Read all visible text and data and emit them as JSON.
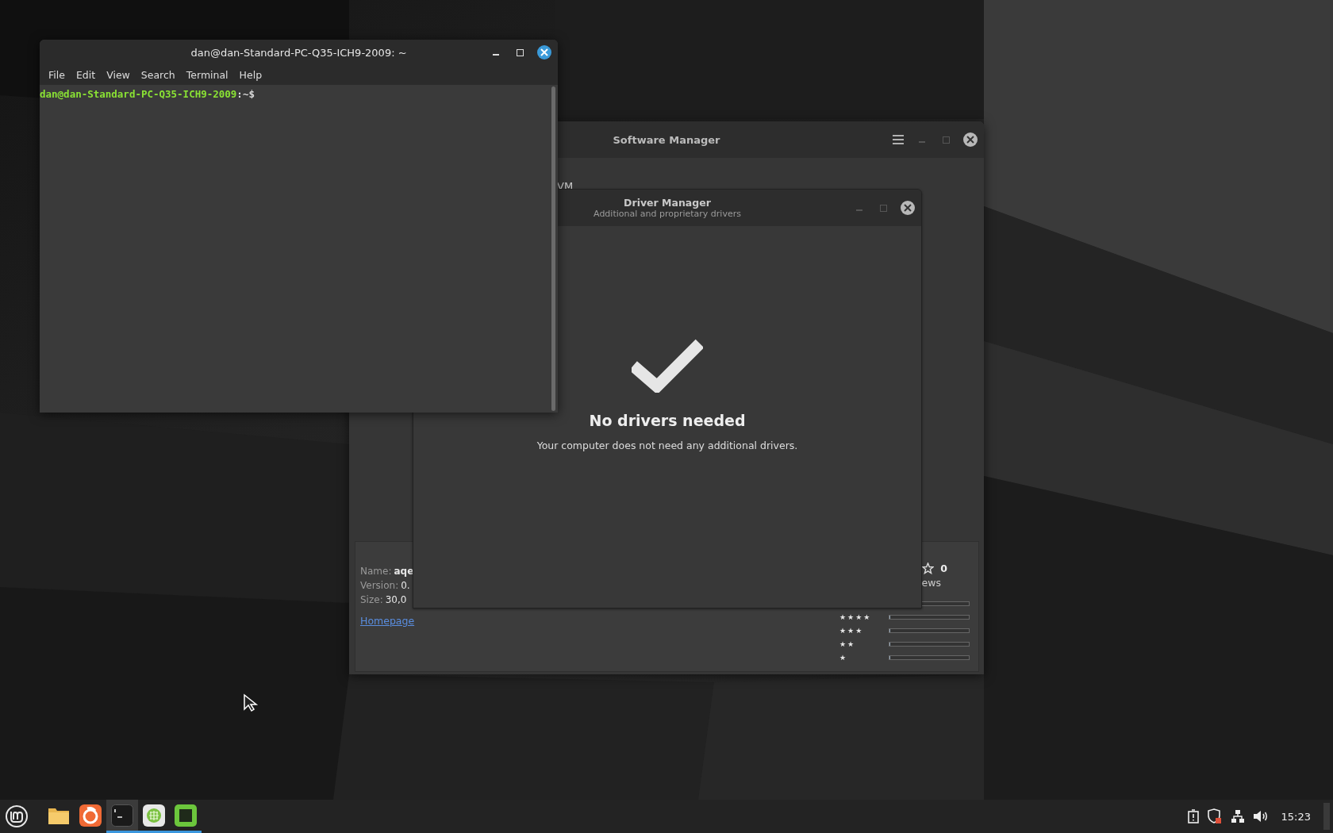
{
  "terminal": {
    "title": "dan@dan-Standard-PC-Q35-ICH9-2009: ~",
    "focused": true,
    "menu": [
      "File",
      "Edit",
      "View",
      "Search",
      "Terminal",
      "Help"
    ],
    "prompt_user": "dan@dan-Standard-PC-Q35-ICH9-2009",
    "prompt_suffix": ":~$"
  },
  "software_manager": {
    "title": "Software Manager",
    "focused": false,
    "fragment": "VM",
    "details": [
      {
        "label": "Name:",
        "value": "aqe",
        "kind": "bold"
      },
      {
        "label": "Version:",
        "value": "0.",
        "kind": "plain"
      },
      {
        "label": "Size:",
        "value": "30,0",
        "kind": "plain"
      }
    ],
    "homepage": "Homepage",
    "rating_count": "0",
    "reviews_fragment": "ews",
    "rating_rows": [
      {
        "level": 0
      },
      {
        "label": "★★★★",
        "level": 0
      },
      {
        "label": "★★★",
        "level": 0
      },
      {
        "label": "★★",
        "level": 0
      },
      {
        "label": "★",
        "level": 0
      }
    ]
  },
  "driver_manager": {
    "title": "Driver Manager",
    "subtitle": "Additional and proprietary drivers",
    "focused": false,
    "heading": "No drivers needed",
    "message": "Your computer does not need any additional drivers."
  },
  "taskbar": {
    "apps": [
      {
        "kind": "folder",
        "running": false,
        "selected": false
      },
      {
        "kind": "browser",
        "running": false,
        "selected": false
      },
      {
        "kind": "terminal",
        "running": true,
        "selected": true
      },
      {
        "kind": "grid",
        "running": true,
        "selected": false
      },
      {
        "kind": "square",
        "running": true,
        "selected": false
      }
    ],
    "clock": "15:23"
  }
}
